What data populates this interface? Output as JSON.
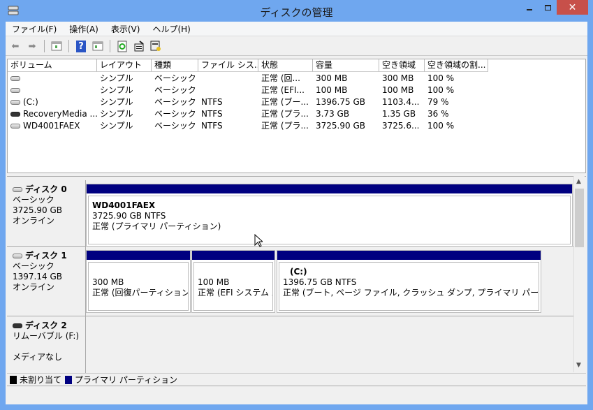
{
  "window": {
    "title": "ディスクの管理",
    "close": "✕"
  },
  "menu": [
    "ファイル(F)",
    "操作(A)",
    "表示(V)",
    "ヘルプ(H)"
  ],
  "toolbar": [
    "back-icon",
    "forward-icon",
    "show-hide-console-tree-icon",
    "help-icon",
    "show-hide-action-pane-icon",
    "refresh-icon",
    "properties-icon",
    "disk-settings-icon"
  ],
  "columns": [
    "ボリューム",
    "レイアウト",
    "種類",
    "ファイル シス...",
    "状態",
    "容量",
    "空き領域",
    "空き領域の割..."
  ],
  "rows": [
    [
      "",
      "シンプル",
      "ベーシック",
      "",
      "正常 (回...",
      "300 MB",
      "300 MB",
      "100 %"
    ],
    [
      "",
      "シンプル",
      "ベーシック",
      "",
      "正常 (EFI...",
      "100 MB",
      "100 MB",
      "100 %"
    ],
    [
      "(C:)",
      "シンプル",
      "ベーシック",
      "NTFS",
      "正常 (ブー...",
      "1396.75 GB",
      "1103.4...",
      "79 %"
    ],
    [
      "RecoveryMedia ...",
      "シンプル",
      "ベーシック",
      "NTFS",
      "正常 (プラ...",
      "3.73 GB",
      "1.35 GB",
      "36 %"
    ],
    [
      "WD4001FAEX",
      "シンプル",
      "ベーシック",
      "NTFS",
      "正常 (プラ...",
      "3725.90 GB",
      "3725.6...",
      "100 %"
    ]
  ],
  "disks": [
    {
      "name": "ディスク 0",
      "type": "ベーシック",
      "size": "3725.90 GB",
      "status": "オンライン",
      "partitions": [
        {
          "name": "WD4001FAEX",
          "size": "3725.90 GB NTFS",
          "status": "正常 (プライマリ パーティション)"
        }
      ]
    },
    {
      "name": "ディスク 1",
      "type": "ベーシック",
      "size": "1397.14 GB",
      "status": "オンライン",
      "partitions": [
        {
          "name": "",
          "size": "300 MB",
          "status": "正常 (回復パーティション)"
        },
        {
          "name": "",
          "size": "100 MB",
          "status": "正常 (EFI システム パ"
        },
        {
          "name": "(C:)",
          "size": "1396.75 GB NTFS",
          "status": "正常 (ブート, ページ ファイル, クラッシュ ダンプ, プライマリ パーティション)"
        }
      ]
    },
    {
      "name": "ディスク 2",
      "type": "リムーバブル (F:)",
      "status": "メディアなし"
    }
  ],
  "legend": [
    {
      "label": "未割り当て",
      "color": "#000000"
    },
    {
      "label": "プライマリ パーティション",
      "color": "#000080"
    }
  ]
}
